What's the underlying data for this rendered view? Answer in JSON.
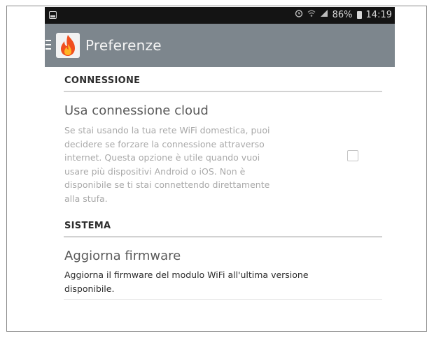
{
  "status_bar": {
    "alarm_icon": "alarm-clock-icon",
    "wifi_icon": "wifi-icon",
    "signal_icon": "signal-icon",
    "battery_percent": "86%",
    "battery_icon": "battery-icon",
    "time": "14:19"
  },
  "app_bar": {
    "menu_icon": "hamburger-menu-icon",
    "logo_icon": "flame-logo-icon",
    "title": "Preferenze"
  },
  "sections": [
    {
      "header": "CONNESSIONE",
      "items": [
        {
          "title": "Usa connessione cloud",
          "summary": "Se stai usando la tua rete WiFi domestica, puoi\ndecidere se forzare la connessione attraverso\ninternet. Questa opzione è utile quando vuoi\nusare più dispositivi Android o iOS. Non è\ndisponibile se ti stai connettendo direttamente\nalla stufa.",
          "checked": false
        }
      ]
    },
    {
      "header": "SISTEMA",
      "items": [
        {
          "title": "Aggiorna firmware",
          "summary": "Aggiorna il firmware del modulo WiFi all'ultima versione\ndisponibile."
        }
      ]
    }
  ],
  "colors": {
    "app_bar": "#7d868d",
    "status_bar": "#141414",
    "logo_flame": "#f04e1e"
  }
}
